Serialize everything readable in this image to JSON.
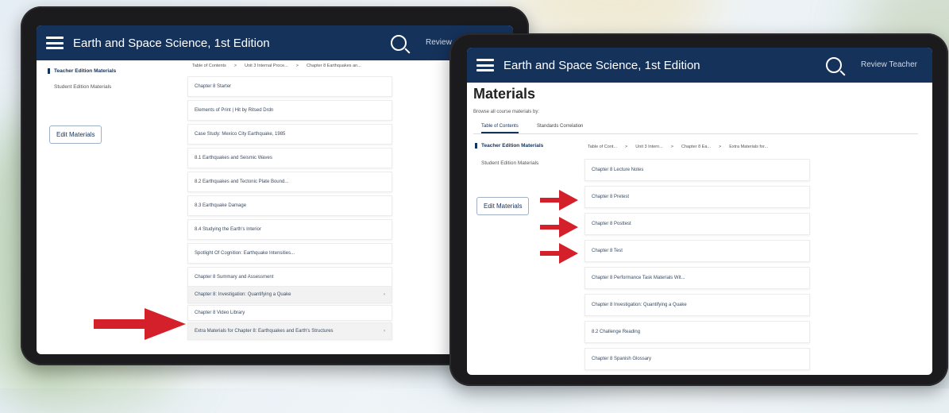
{
  "left_screen": {
    "app_title": "Earth and Space Science, 1st Edition",
    "review_link": "Review",
    "sidebar": {
      "teacher_materials": "Teacher Edition Materials",
      "student_materials": "Student Edition Materials"
    },
    "edit_button": "Edit Materials",
    "breadcrumb": [
      "Table of Contents",
      "Unit 3 Internal Proce...",
      "Chapter 8 Earthquakes an..."
    ],
    "rows": [
      {
        "label": "Chapter 8 Starter",
        "group": false
      },
      {
        "label": "Elements of Print | Hit by Ritsed Drdn",
        "group": false
      },
      {
        "label": "Case Study: Mexico City Earthquake, 1985",
        "group": false
      },
      {
        "label": "8.1 Earthquakes and Seismic Waves",
        "group": false
      },
      {
        "label": "8.2 Earthquakes and Tectonic Plate Bound...",
        "group": false
      },
      {
        "label": "8.3 Earthquake Damage",
        "group": false
      },
      {
        "label": "8.4 Studying the Earth's Interior",
        "group": false
      },
      {
        "label": "Spotlight Of Cognition: Earthquake Intensities...",
        "group": false
      },
      {
        "label": "Chapter 8 Summary and Assessment",
        "group": false
      },
      {
        "label": "Chapter 8: Investigation: Quantifying a Quake",
        "group": true
      },
      {
        "label": "Chapter 8 Video Library",
        "group": false
      },
      {
        "label": "Extra Materials for Chapter 8: Earthquakes and Earth's Structures",
        "group": true
      }
    ]
  },
  "right_screen": {
    "app_title": "Earth and Space Science, 1st Edition",
    "review_link": "Review Teacher",
    "page_heading": "Materials",
    "browse_label": "Browse all course materials by:",
    "tabs": [
      "Table of Contents",
      "Standards Correlation"
    ],
    "sidebar": {
      "teacher_materials": "Teacher Edition Materials",
      "student_materials": "Student Edition Materials"
    },
    "edit_button": "Edit Materials",
    "breadcrumb": [
      "Table of Cont...",
      "Unit 3 Intern...",
      "Chapter 8 Ea...",
      "Extra Materials for..."
    ],
    "rows": [
      "Chapter 8 Lecture Notes",
      "Chapter 8 Pretest",
      "Chapter 8 Posttest",
      "Chapter 8 Test",
      "Chapter 8 Performance Task Materials Wit...",
      "Chapter 8 Investigation: Quantifying a Quake",
      "8.2 Challenge Reading",
      "Chapter 8 Spanish Glossary"
    ]
  },
  "colors": {
    "header": "#15325b",
    "arrow": "#d4202a"
  }
}
